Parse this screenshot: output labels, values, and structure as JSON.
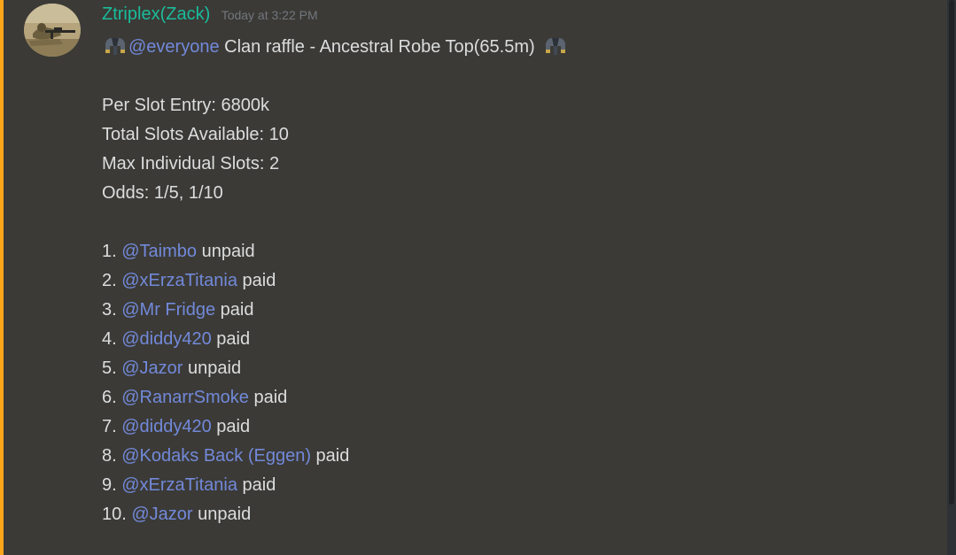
{
  "message": {
    "author": "Ztriplex(Zack)",
    "timestamp": "Today at 3:22 PM",
    "author_color": "#1abc9c",
    "avatar_icon": "soldier-sniper-avatar",
    "emoji_icon": "ancestral-robe-top-icon",
    "headline": {
      "mention": "@everyone",
      "text": " Clan raffle - Ancestral Robe Top(65.5m)"
    },
    "details": [
      "Per Slot Entry: 6800k",
      "Total Slots Available: 10",
      "Max Individual Slots: 2",
      "Odds: 1/5, 1/10"
    ],
    "entries": [
      {
        "number": "1. ",
        "mention": "@Taimbo",
        "status": " unpaid"
      },
      {
        "number": "2. ",
        "mention": "@xErzaTitania",
        "status": " paid"
      },
      {
        "number": "3. ",
        "mention": "@Mr Fridge",
        "status": " paid"
      },
      {
        "number": "4. ",
        "mention": "@diddy420",
        "status": " paid"
      },
      {
        "number": "5. ",
        "mention": "@Jazor",
        "status": " unpaid"
      },
      {
        "number": "6. ",
        "mention": "@RanarrSmoke",
        "status": " paid"
      },
      {
        "number": "7. ",
        "mention": "@diddy420",
        "status": " paid"
      },
      {
        "number": "8. ",
        "mention": "@Kodaks Back (Eggen)",
        "status": " paid"
      },
      {
        "number": "9. ",
        "mention": "@xErzaTitania",
        "status": " paid"
      },
      {
        "number": "10. ",
        "mention": "@Jazor",
        "status": " unpaid"
      }
    ],
    "colors": {
      "mention": "#7289da",
      "highlight": "#faa61a",
      "text": "#dcddde",
      "timestamp": "#72767d"
    }
  }
}
